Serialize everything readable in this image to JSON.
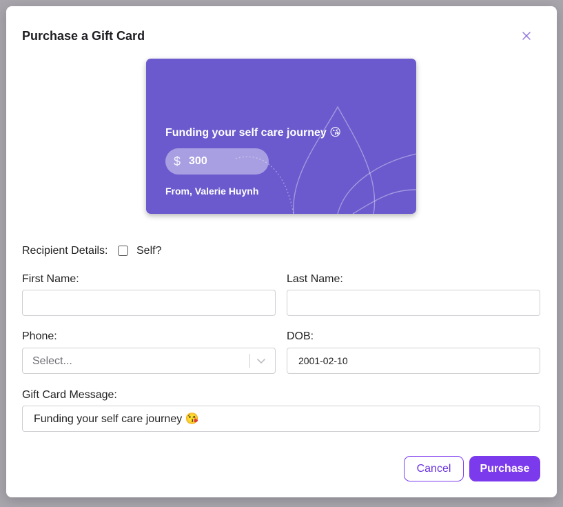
{
  "modal": {
    "title": "Purchase a Gift Card"
  },
  "card": {
    "message": "Funding your self care journey 😘",
    "currency_symbol": "$",
    "amount": "300",
    "from": "From, Valerie Huynh",
    "color": "#6a5acd"
  },
  "form": {
    "recipient_label": "Recipient Details:",
    "self_label": "Self?",
    "self_checked": false,
    "first_name_label": "First Name:",
    "first_name_value": "",
    "last_name_label": "Last Name:",
    "last_name_value": "",
    "phone_label": "Phone:",
    "phone_placeholder": "Select...",
    "dob_label": "DOB:",
    "dob_value": "2001-02-10",
    "message_label": "Gift Card Message:",
    "message_value": "Funding your self care journey 😘"
  },
  "actions": {
    "cancel_label": "Cancel",
    "purchase_label": "Purchase",
    "accent": "#7c3aed"
  },
  "icons": {
    "close": "close-icon",
    "chevron": "chevron-down-icon"
  }
}
